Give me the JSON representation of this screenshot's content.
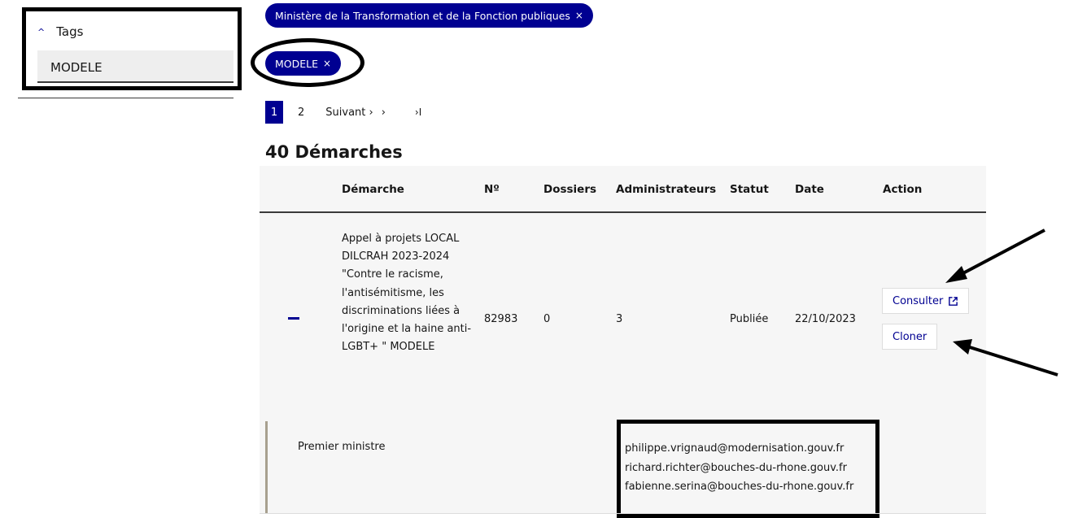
{
  "sidebar": {
    "tags_label": "Tags",
    "tags_value": "MODELE"
  },
  "filters": {
    "ministry_pill": "Ministère de la Transformation et de la Fonction publiques",
    "tag_pill": "MODELE",
    "remove_glyph": "×"
  },
  "pagination": {
    "current": "1",
    "page2": "2",
    "next": "Suivant ›",
    "next_arrow": "›",
    "last": "›I"
  },
  "heading": "40 Démarches",
  "table": {
    "headers": [
      "Démarche",
      "Nº",
      "Dossiers",
      "Administrateurs",
      "Statut",
      "Date",
      "Action"
    ],
    "row": {
      "demarche": "Appel à projets LOCAL DILCRAH 2023-2024 \"Contre le racisme, l'antisémitisme, les discriminations liées à l'origine et la haine anti-LGBT+ \" MODELE",
      "numero": "82983",
      "dossiers": "0",
      "administrateurs": "3",
      "statut": "Publiée",
      "date": "22/10/2023",
      "consulter": "Consulter",
      "cloner": "Cloner"
    },
    "detail": {
      "organisation": "Premier ministre",
      "emails": [
        "philippe.vrignaud@modernisation.gouv.fr",
        "richard.richter@bouches-du-rhone.gouv.fr",
        "fabienne.serina@bouches-du-rhone.gouv.fr"
      ]
    }
  },
  "colors": {
    "primary": "#000091",
    "row_bg": "#f6f6f6",
    "annotation": "#000000"
  }
}
